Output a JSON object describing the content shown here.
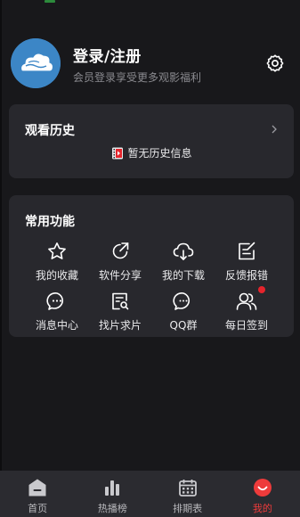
{
  "header": {
    "login_title": "登录/注册",
    "login_subtitle": "会员登录享受更多观影福利",
    "avatar_icon": "cloud-icon",
    "settings_icon": "gear-icon"
  },
  "history": {
    "title": "观看历史",
    "empty_text": "暂无历史信息",
    "chevron_icon": "chevron-right-icon"
  },
  "features": {
    "title": "常用功能",
    "items": [
      {
        "label": "我的收藏",
        "icon": "star-icon"
      },
      {
        "label": "软件分享",
        "icon": "share-icon"
      },
      {
        "label": "我的下载",
        "icon": "cloud-download-icon"
      },
      {
        "label": "反馈报错",
        "icon": "feedback-edit-icon"
      },
      {
        "label": "消息中心",
        "icon": "message-icon"
      },
      {
        "label": "找片求片",
        "icon": "search-doc-icon"
      },
      {
        "label": "QQ群",
        "icon": "chat-icon"
      },
      {
        "label": "每日签到",
        "icon": "users-icon"
      }
    ]
  },
  "bottom_nav": {
    "items": [
      {
        "label": "首页",
        "icon": "home-icon"
      },
      {
        "label": "热播榜",
        "icon": "bar-chart-icon"
      },
      {
        "label": "排期表",
        "icon": "calendar-icon"
      },
      {
        "label": "我的",
        "icon": "smile-icon"
      }
    ],
    "active_index": 3
  },
  "colors": {
    "background": "#18181b",
    "card": "#28282d",
    "accent": "#ee3b3b",
    "avatar": "#3c86c6"
  }
}
